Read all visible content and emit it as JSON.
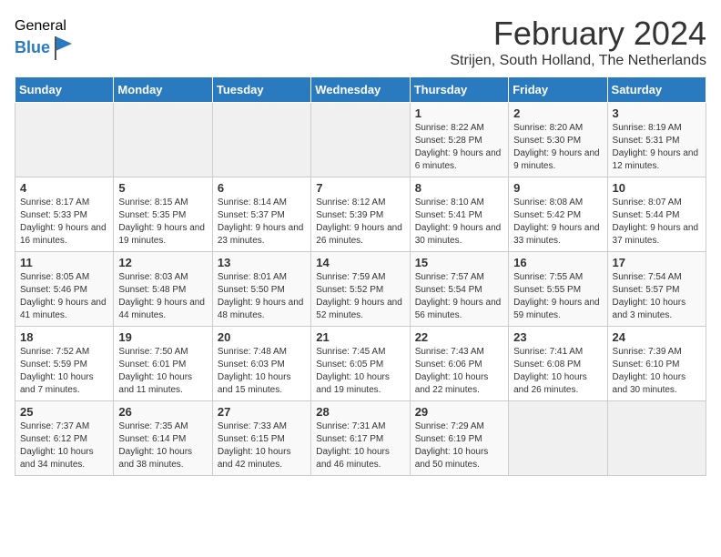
{
  "logo": {
    "general": "General",
    "blue": "Blue"
  },
  "title": {
    "month_year": "February 2024",
    "location": "Strijen, South Holland, The Netherlands"
  },
  "weekdays": [
    "Sunday",
    "Monday",
    "Tuesday",
    "Wednesday",
    "Thursday",
    "Friday",
    "Saturday"
  ],
  "weeks": [
    [
      {
        "day": "",
        "info": ""
      },
      {
        "day": "",
        "info": ""
      },
      {
        "day": "",
        "info": ""
      },
      {
        "day": "",
        "info": ""
      },
      {
        "day": "1",
        "info": "Sunrise: 8:22 AM\nSunset: 5:28 PM\nDaylight: 9 hours\nand 6 minutes."
      },
      {
        "day": "2",
        "info": "Sunrise: 8:20 AM\nSunset: 5:30 PM\nDaylight: 9 hours\nand 9 minutes."
      },
      {
        "day": "3",
        "info": "Sunrise: 8:19 AM\nSunset: 5:31 PM\nDaylight: 9 hours\nand 12 minutes."
      }
    ],
    [
      {
        "day": "4",
        "info": "Sunrise: 8:17 AM\nSunset: 5:33 PM\nDaylight: 9 hours\nand 16 minutes."
      },
      {
        "day": "5",
        "info": "Sunrise: 8:15 AM\nSunset: 5:35 PM\nDaylight: 9 hours\nand 19 minutes."
      },
      {
        "day": "6",
        "info": "Sunrise: 8:14 AM\nSunset: 5:37 PM\nDaylight: 9 hours\nand 23 minutes."
      },
      {
        "day": "7",
        "info": "Sunrise: 8:12 AM\nSunset: 5:39 PM\nDaylight: 9 hours\nand 26 minutes."
      },
      {
        "day": "8",
        "info": "Sunrise: 8:10 AM\nSunset: 5:41 PM\nDaylight: 9 hours\nand 30 minutes."
      },
      {
        "day": "9",
        "info": "Sunrise: 8:08 AM\nSunset: 5:42 PM\nDaylight: 9 hours\nand 33 minutes."
      },
      {
        "day": "10",
        "info": "Sunrise: 8:07 AM\nSunset: 5:44 PM\nDaylight: 9 hours\nand 37 minutes."
      }
    ],
    [
      {
        "day": "11",
        "info": "Sunrise: 8:05 AM\nSunset: 5:46 PM\nDaylight: 9 hours\nand 41 minutes."
      },
      {
        "day": "12",
        "info": "Sunrise: 8:03 AM\nSunset: 5:48 PM\nDaylight: 9 hours\nand 44 minutes."
      },
      {
        "day": "13",
        "info": "Sunrise: 8:01 AM\nSunset: 5:50 PM\nDaylight: 9 hours\nand 48 minutes."
      },
      {
        "day": "14",
        "info": "Sunrise: 7:59 AM\nSunset: 5:52 PM\nDaylight: 9 hours\nand 52 minutes."
      },
      {
        "day": "15",
        "info": "Sunrise: 7:57 AM\nSunset: 5:54 PM\nDaylight: 9 hours\nand 56 minutes."
      },
      {
        "day": "16",
        "info": "Sunrise: 7:55 AM\nSunset: 5:55 PM\nDaylight: 9 hours\nand 59 minutes."
      },
      {
        "day": "17",
        "info": "Sunrise: 7:54 AM\nSunset: 5:57 PM\nDaylight: 10 hours\nand 3 minutes."
      }
    ],
    [
      {
        "day": "18",
        "info": "Sunrise: 7:52 AM\nSunset: 5:59 PM\nDaylight: 10 hours\nand 7 minutes."
      },
      {
        "day": "19",
        "info": "Sunrise: 7:50 AM\nSunset: 6:01 PM\nDaylight: 10 hours\nand 11 minutes."
      },
      {
        "day": "20",
        "info": "Sunrise: 7:48 AM\nSunset: 6:03 PM\nDaylight: 10 hours\nand 15 minutes."
      },
      {
        "day": "21",
        "info": "Sunrise: 7:45 AM\nSunset: 6:05 PM\nDaylight: 10 hours\nand 19 minutes."
      },
      {
        "day": "22",
        "info": "Sunrise: 7:43 AM\nSunset: 6:06 PM\nDaylight: 10 hours\nand 22 minutes."
      },
      {
        "day": "23",
        "info": "Sunrise: 7:41 AM\nSunset: 6:08 PM\nDaylight: 10 hours\nand 26 minutes."
      },
      {
        "day": "24",
        "info": "Sunrise: 7:39 AM\nSunset: 6:10 PM\nDaylight: 10 hours\nand 30 minutes."
      }
    ],
    [
      {
        "day": "25",
        "info": "Sunrise: 7:37 AM\nSunset: 6:12 PM\nDaylight: 10 hours\nand 34 minutes."
      },
      {
        "day": "26",
        "info": "Sunrise: 7:35 AM\nSunset: 6:14 PM\nDaylight: 10 hours\nand 38 minutes."
      },
      {
        "day": "27",
        "info": "Sunrise: 7:33 AM\nSunset: 6:15 PM\nDaylight: 10 hours\nand 42 minutes."
      },
      {
        "day": "28",
        "info": "Sunrise: 7:31 AM\nSunset: 6:17 PM\nDaylight: 10 hours\nand 46 minutes."
      },
      {
        "day": "29",
        "info": "Sunrise: 7:29 AM\nSunset: 6:19 PM\nDaylight: 10 hours\nand 50 minutes."
      },
      {
        "day": "",
        "info": ""
      },
      {
        "day": "",
        "info": ""
      }
    ]
  ]
}
